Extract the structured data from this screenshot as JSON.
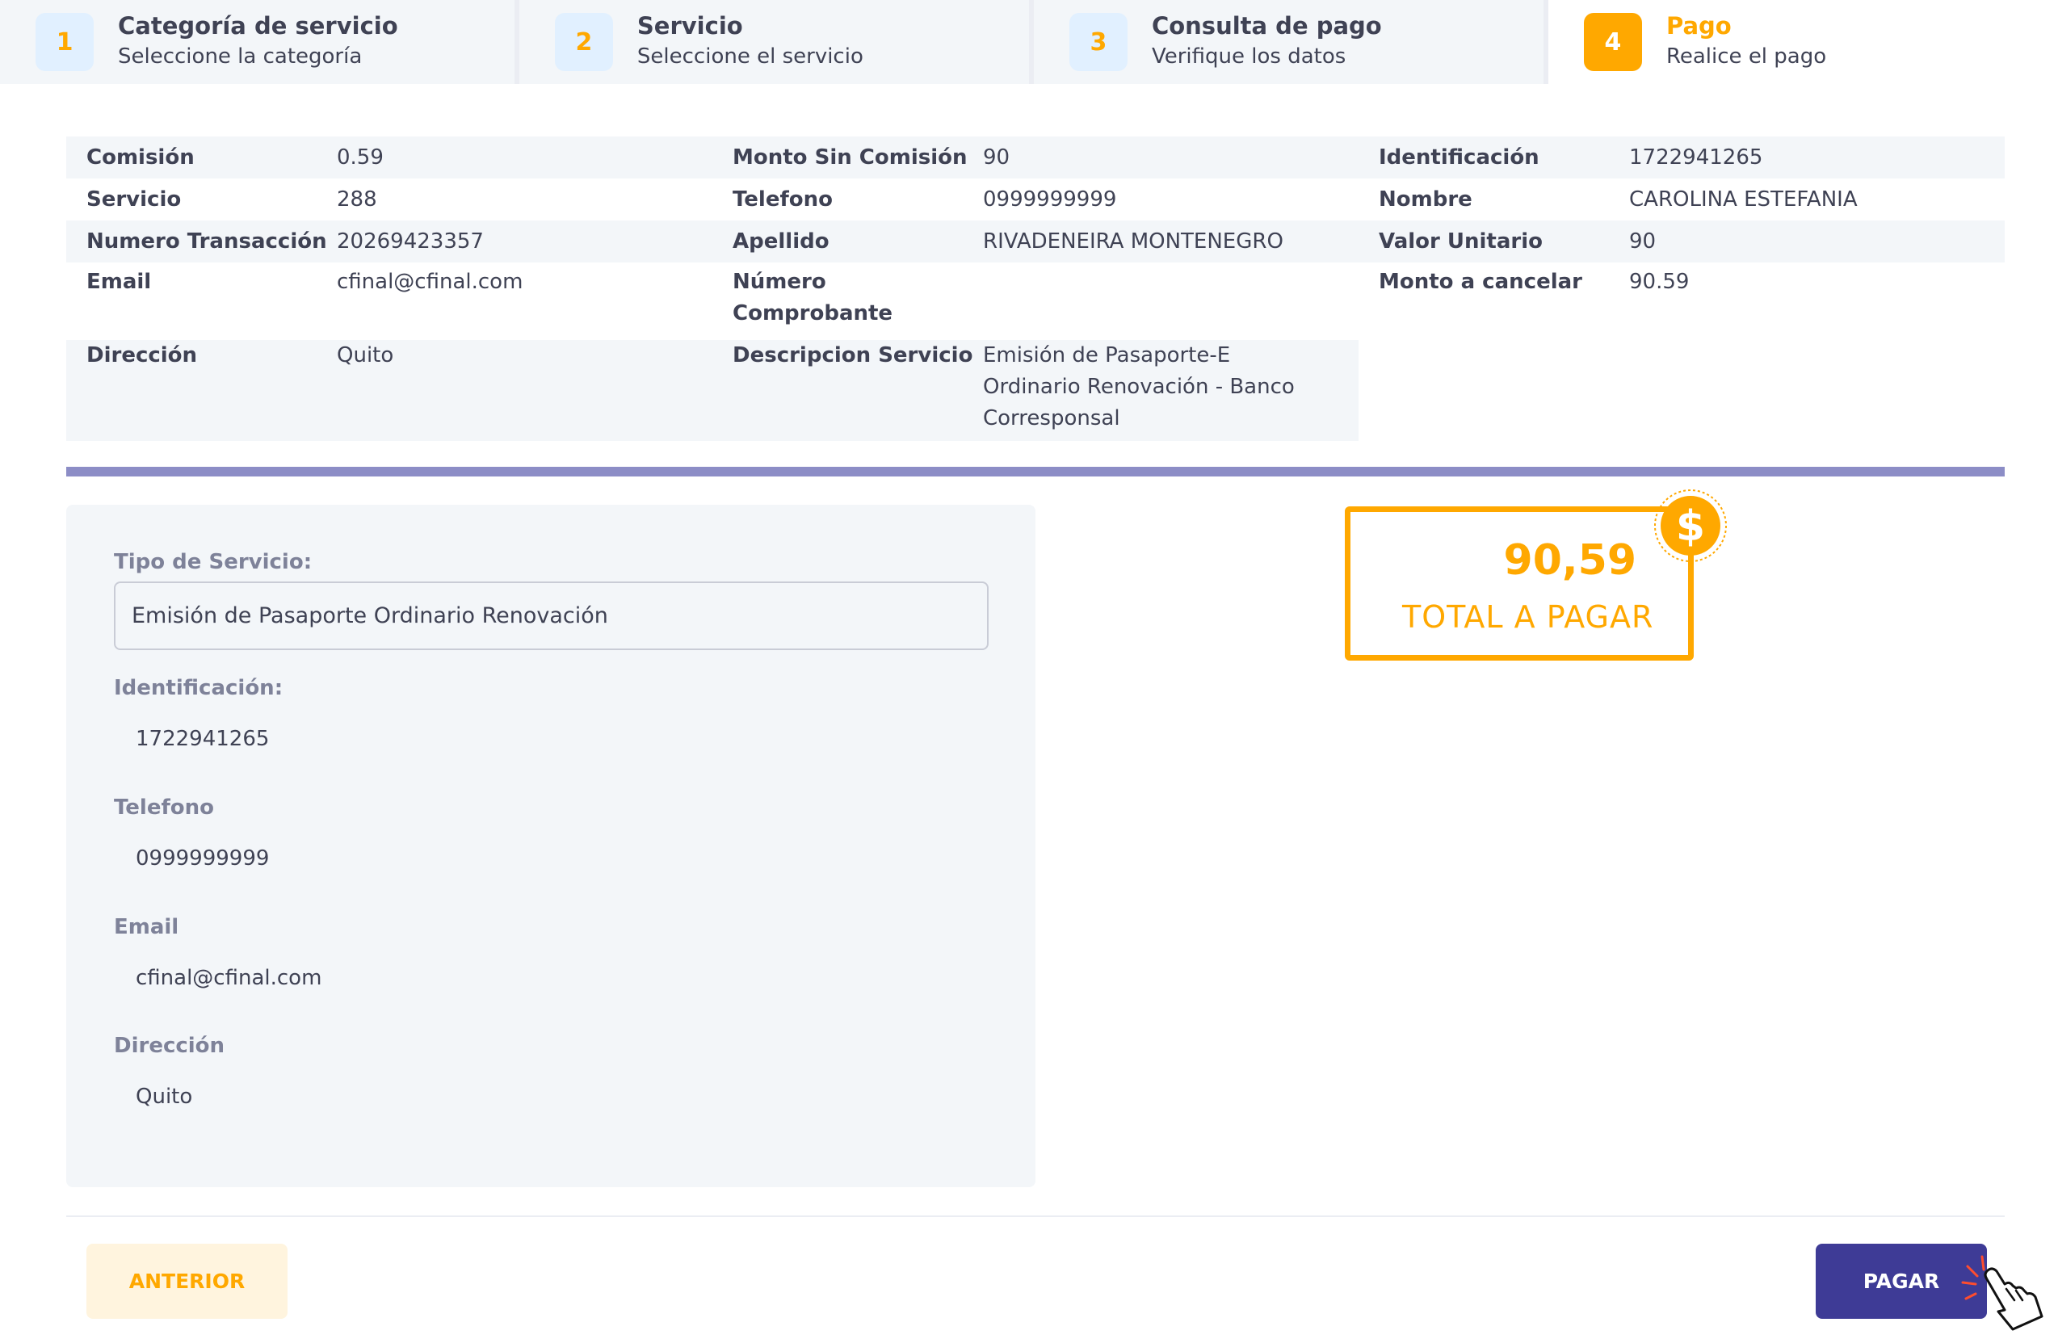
{
  "steps": [
    {
      "num": "1",
      "title": "Categoría de servicio",
      "desc": "Seleccione la categoría",
      "active": false
    },
    {
      "num": "2",
      "title": "Servicio",
      "desc": "Seleccione el servicio",
      "active": false
    },
    {
      "num": "3",
      "title": "Consulta de pago",
      "desc": "Verifique los datos",
      "active": false
    },
    {
      "num": "4",
      "title": "Pago",
      "desc": "Realice el pago",
      "active": true
    }
  ],
  "details": {
    "row1": [
      {
        "label": "Comisión",
        "value": "0.59"
      },
      {
        "label": "Monto Sin Comisión",
        "value": "90"
      },
      {
        "label": "Identificación",
        "value": "1722941265"
      }
    ],
    "row2": [
      {
        "label": "Servicio",
        "value": "288"
      },
      {
        "label": "Telefono",
        "value": "0999999999"
      },
      {
        "label": "Nombre",
        "value": "CAROLINA ESTEFANIA"
      }
    ],
    "row3": [
      {
        "label": "Numero Transacción",
        "value": "20269423357"
      },
      {
        "label": "Apellido",
        "value": "RIVADENEIRA MONTENEGRO"
      },
      {
        "label": "Valor Unitario",
        "value": "90"
      }
    ],
    "row4": [
      {
        "label": "Email",
        "value": "cfinal@cfinal.com"
      },
      {
        "label": "Número Comprobante",
        "value": ""
      },
      {
        "label": "Monto a cancelar",
        "value": "90.59"
      }
    ],
    "row5": [
      {
        "label": "Dirección",
        "value": "Quito"
      },
      {
        "label": "Descripcion Servicio",
        "value": "Emisión de Pasaporte-E Ordinario Renovación - Banco Corresponsal"
      }
    ]
  },
  "form": {
    "tipo_label": "Tipo de Servicio:",
    "tipo_value": "Emisión de Pasaporte Ordinario Renovación",
    "id_label": "Identificación:",
    "id_value": "1722941265",
    "tel_label": "Telefono",
    "tel_value": "0999999999",
    "email_label": "Email",
    "email_value": "cfinal@cfinal.com",
    "dir_label": "Dirección",
    "dir_value": "Quito"
  },
  "total": {
    "amount": "90,59",
    "label": "TOTAL A PAGAR",
    "coin_symbol": "$"
  },
  "buttons": {
    "prev": "ANTERIOR",
    "pay": "PAGAR"
  },
  "colors": {
    "accent": "#ffa800",
    "primary": "#3e3b96",
    "divider": "#8c8dc6"
  }
}
